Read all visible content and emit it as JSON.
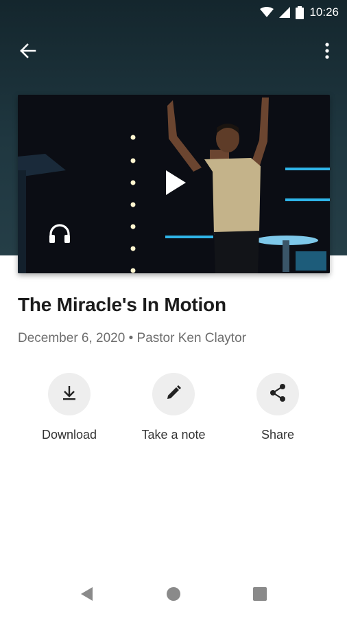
{
  "status_bar": {
    "time": "10:26",
    "icons": [
      "wifi-icon",
      "signal-icon",
      "battery-icon"
    ]
  },
  "app_bar": {
    "back_icon": "arrow-back-icon",
    "more_icon": "more-vert-icon"
  },
  "video": {
    "play_icon": "play-icon",
    "audio_icon": "headphones-icon"
  },
  "sermon": {
    "title": "The Miracle's In Motion",
    "meta": "December 6, 2020 • Pastor Ken Claytor"
  },
  "actions": [
    {
      "label": "Download",
      "icon": "download-icon"
    },
    {
      "label": "Take a note",
      "icon": "pencil-icon"
    },
    {
      "label": "Share",
      "icon": "share-icon"
    }
  ],
  "nav": {
    "icons": [
      "nav-back-icon",
      "nav-home-icon",
      "nav-recents-icon"
    ]
  },
  "colors": {
    "header_top": "#14262d",
    "header_bottom": "#253e47",
    "action_bg": "#eeeeee",
    "title": "#1b1b1b",
    "meta": "#6d6d6d"
  }
}
